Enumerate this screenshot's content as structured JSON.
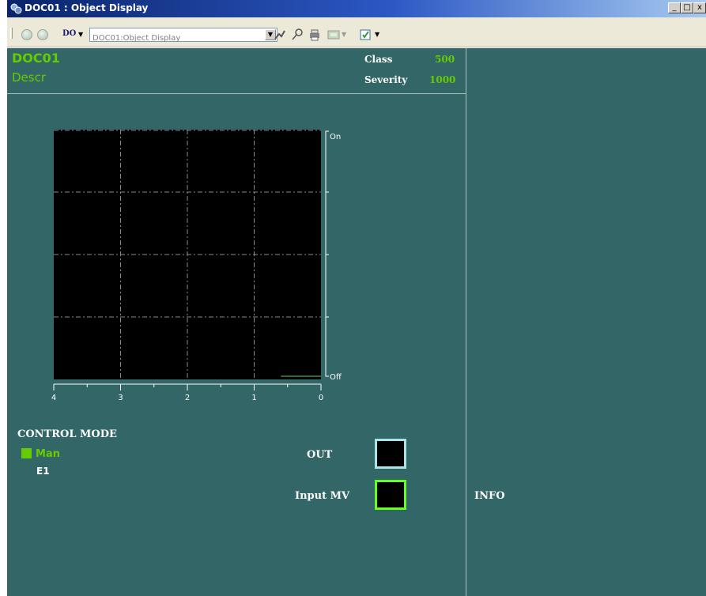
{
  "window": {
    "title": "DOC01 : Object Display",
    "min_glyph": "_",
    "max_glyph": "□",
    "close_glyph": "x"
  },
  "toolbar": {
    "object_type": "DO",
    "address_value": "DOC01:Object Display",
    "icons": [
      "back-icon",
      "forward-icon",
      "tag-dropdown-icon",
      "trend-icon",
      "pin-icon",
      "print-icon",
      "faceplate-icon",
      "help-icon"
    ]
  },
  "header": {
    "name": "DOC01",
    "description": "Descr",
    "class_label": "Class",
    "class_value": "500",
    "severity_label": "Severity",
    "severity_value": "1000"
  },
  "chart_data": {
    "type": "line",
    "x_ticks": [
      "4",
      "3",
      "2",
      "1",
      "0"
    ],
    "x_range": [
      4,
      0
    ],
    "y_categories": [
      "Off",
      "On"
    ],
    "series": [
      {
        "x": [
          0.6,
          0.0
        ],
        "y": [
          "Off",
          "Off"
        ],
        "color": "#2e6b2e"
      }
    ],
    "grid": true,
    "background": "#000000"
  },
  "control_mode": {
    "title": "CONTROL MODE",
    "mode": "Man",
    "mode_color": "#66cc00",
    "sub_mode": "E1"
  },
  "outputs": {
    "out_label": "OUT",
    "input_mv_label": "Input MV"
  },
  "info": {
    "label": "INFO"
  },
  "colors": {
    "panel_bg": "#336666",
    "accent_green": "#66cc00",
    "out_border": "#a8e4e8",
    "input_mv_border": "#66ff22"
  }
}
